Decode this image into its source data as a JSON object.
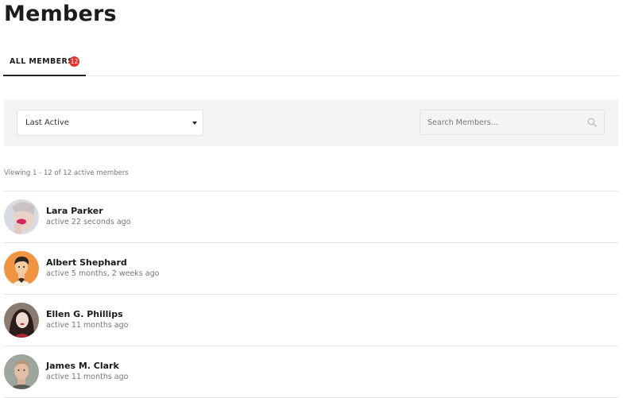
{
  "page": {
    "title": "Members"
  },
  "tabs": [
    {
      "label": "ALL MEMBERS",
      "count": "12"
    }
  ],
  "filters": {
    "order_by": "Last Active",
    "search_placeholder": "Search Members..."
  },
  "summary": "Viewing 1 - 12 of 12 active members",
  "members": [
    {
      "name": "Lara Parker",
      "last_active": "active 22 seconds ago",
      "avatar_icon": "woman-with-pink-lips-avatar"
    },
    {
      "name": "Albert Shephard",
      "last_active": "active 5 months, 2 weeks ago",
      "avatar_icon": "illustrated-man-orange-avatar"
    },
    {
      "name": "Ellen G. Phillips",
      "last_active": "active 11 months ago",
      "avatar_icon": "woman-dark-hair-avatar"
    },
    {
      "name": "James M. Clark",
      "last_active": "active 11 months ago",
      "avatar_icon": "man-short-hair-avatar"
    }
  ],
  "colors": {
    "badge": "#e2342d",
    "filter_bar_bg": "#f4f4f4",
    "active_tab_underline": "#222222"
  }
}
